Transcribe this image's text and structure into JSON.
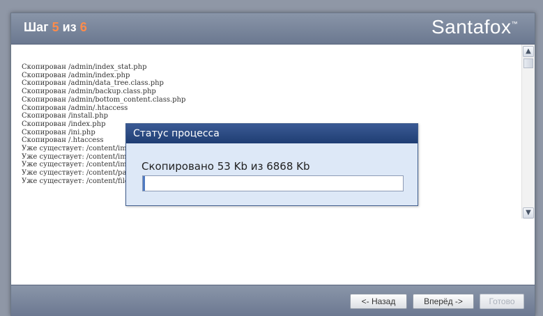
{
  "header": {
    "step_prefix": "Шаг",
    "step_current": "5",
    "step_separator": "из",
    "step_total": "6",
    "brand": "Santafox",
    "brand_tm": "™"
  },
  "log": [
    "Скопирован /admin/index_stat.php",
    "Скопирован /admin/index.php",
    "Скопирован /admin/data_tree.class.php",
    "Скопирован /admin/backup.class.php",
    "Скопирован /admin/bottom_content.class.php",
    "Скопирован /admin/.htaccess",
    "Скопирован /install.php",
    "Скопирован /index.php",
    "Скопирован /ini.php",
    "Скопирован /.htaccess",
    "Уже существует: /content/images",
    "Уже существует: /content/images",
    "Уже существует: /content/images",
    "Уже существует: /content/pages",
    "Уже существует: /content/files"
  ],
  "dialog": {
    "title": "Статус процесса",
    "status_text": "Скопировано 53 Kb из 6868 Kb",
    "progress_fraction": 0.0077
  },
  "footer": {
    "back_label": "<- Назад",
    "next_label": "Вперёд ->",
    "done_label": "Готово"
  },
  "colors": {
    "accent_step": "#ff8b4a",
    "dialog_header": "#1f3d73",
    "progress_fill": "#4f7ac2"
  }
}
